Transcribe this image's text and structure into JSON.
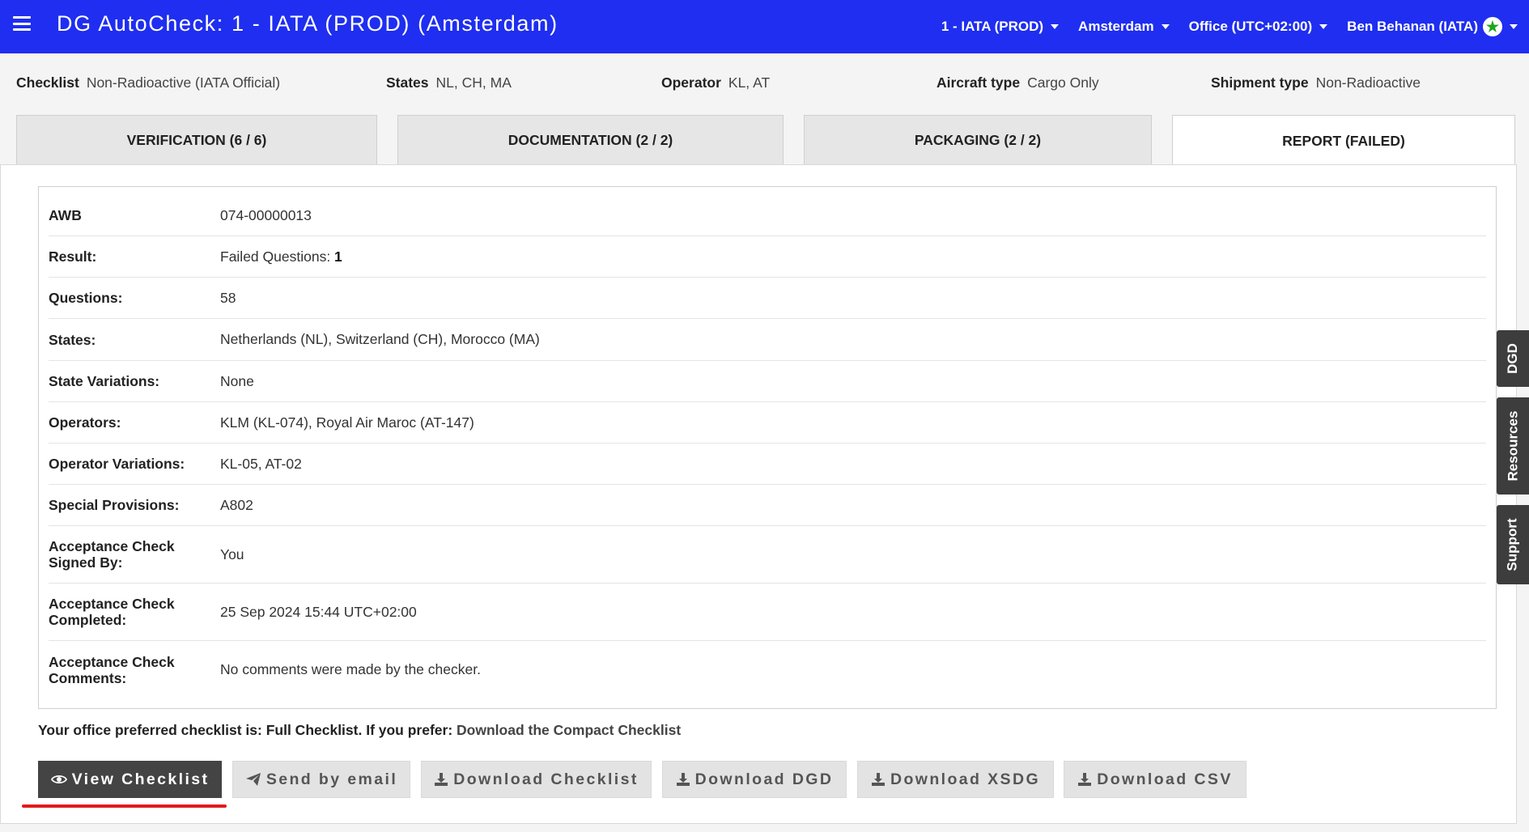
{
  "header": {
    "app_title": "DG AutoCheck: 1 - IATA (PROD) (Amsterdam)",
    "menus": {
      "environment": "1 - IATA (PROD)",
      "location": "Amsterdam",
      "office": "Office (UTC+02:00)",
      "user": "Ben Behanan (IATA)"
    }
  },
  "summary": {
    "checklist_label": "Checklist",
    "checklist_value": "Non-Radioactive (IATA Official)",
    "states_label": "States",
    "states_value": "NL, CH, MA",
    "operator_label": "Operator",
    "operator_value": "KL, AT",
    "aircraft_label": "Aircraft type",
    "aircraft_value": "Cargo Only",
    "shipment_label": "Shipment type",
    "shipment_value": "Non-Radioactive"
  },
  "tabs": [
    {
      "label": "VERIFICATION (6 / 6)"
    },
    {
      "label": "DOCUMENTATION (2 / 2)"
    },
    {
      "label": "PACKAGING (2 / 2)"
    },
    {
      "label": "REPORT (FAILED)"
    }
  ],
  "report": {
    "awb_label": "AWB",
    "awb_value": "074-00000013",
    "result_label": "Result:",
    "result_prefix": "Failed Questions: ",
    "result_failed_count": "1",
    "questions_label": "Questions:",
    "questions_value": "58",
    "states_label": "States:",
    "states_value": "Netherlands (NL), Switzerland (CH), Morocco (MA)",
    "state_variations_label": "State Variations:",
    "state_variations_value": "None",
    "operators_label": "Operators:",
    "operators_value": "KLM (KL-074), Royal Air Maroc (AT-147)",
    "operator_variations_label": "Operator Variations:",
    "operator_variations_value": "KL-05, AT-02",
    "special_provisions_label": "Special Provisions:",
    "special_provisions_value": "A802",
    "signed_by_label_1": "Acceptance Check",
    "signed_by_label_2": "Signed By:",
    "signed_by_value": "You",
    "completed_label_1": "Acceptance Check",
    "completed_label_2": "Completed:",
    "completed_value": "25 Sep 2024 15:44 UTC+02:00",
    "comments_label_1": "Acceptance Check",
    "comments_label_2": "Comments:",
    "comments_value": "No comments were made by the checker."
  },
  "preference": {
    "text": "Your office preferred checklist is: Full Checklist. If you prefer: ",
    "link": "Download the Compact Checklist"
  },
  "buttons": {
    "view_checklist": "View Checklist",
    "send_email": "Send by email",
    "download_checklist": "Download Checklist",
    "download_dgd": "Download DGD",
    "download_xsdg": "Download XSDG",
    "download_csv": "Download CSV"
  },
  "side_tabs": {
    "dgd": "DGD",
    "resources": "Resources",
    "support": "Support"
  },
  "colors": {
    "topbar": "#1f2ef0",
    "primary_button": "#444444",
    "underline": "#e01b1b",
    "user_badge_star": "#1ea51e"
  },
  "icons": {
    "menu": "hamburger-icon",
    "view": "eye-icon",
    "email": "paper-plane-icon",
    "download": "download-icon",
    "user_badge": "star-icon",
    "dropdown": "caret-down-icon"
  }
}
